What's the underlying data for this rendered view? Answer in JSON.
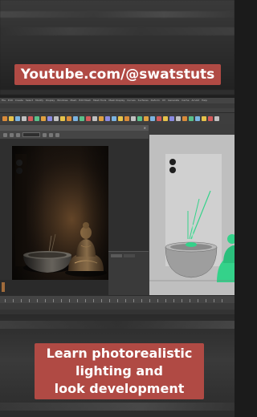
{
  "overlay": {
    "top_caption": "Youtube.com/@swatstuts",
    "bottom_caption_lines": [
      "Learn photorealistic",
      "lighting and",
      "look development"
    ],
    "caption_color": "#b04a44"
  },
  "app": {
    "menu_items": [
      "File",
      "Edit",
      "Create",
      "Select",
      "Modify",
      "Display",
      "Windows",
      "Mesh",
      "Edit Mesh",
      "Mesh Tools",
      "Mesh Display",
      "Curves",
      "Surfaces",
      "Deform",
      "UV",
      "Generate",
      "Cache",
      "Arnold",
      "Help"
    ],
    "render_view_title": "Render View",
    "render_view_close": "×",
    "viewport_label": "persp"
  },
  "icons": {
    "close": "close-icon",
    "shelf_tools": "shelf-tool-icon"
  },
  "colors": {
    "render_bg": "#1d150f",
    "statue": "#8a6a43",
    "bowl": "#4e4b46",
    "viewport_bg": "#bfbfbf",
    "selection_green": "#34d28a"
  }
}
